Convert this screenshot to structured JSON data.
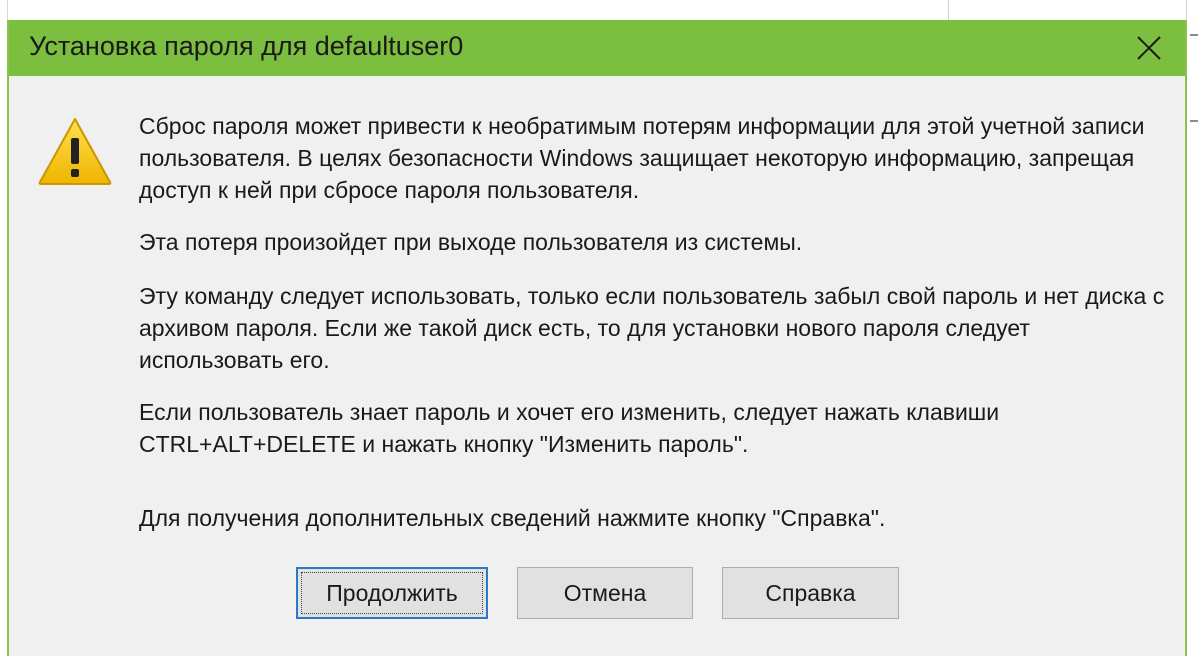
{
  "window": {
    "title": "Установка пароля для defaultuser0"
  },
  "message": {
    "paragraph_1": "Сброс пароля может привести к необратимым потерям информации для этой учетной записи пользователя. В целях безопасности Windows защищает некоторую информацию, запрещая доступ к ней при сбросе пароля пользователя.",
    "paragraph_2": "Эта потеря произойдет при выходе пользователя из системы.",
    "paragraph_3": "Эту команду следует использовать, только если пользователь забыл свой пароль и нет диска с архивом пароля. Если же такой диск есть, то для установки нового пароля следует использовать его.",
    "paragraph_4": "Если пользователь знает пароль и хочет его изменить, следует нажать клавиши CTRL+ALT+DELETE и нажать кнопку \"Изменить пароль\".",
    "paragraph_5": "Для получения дополнительных сведений нажмите кнопку \"Справка\"."
  },
  "buttons": {
    "continue_label": "Продолжить",
    "cancel_label": "Отмена",
    "help_label": "Справка"
  },
  "icons": {
    "warning": "warning-icon",
    "close": "close-icon"
  },
  "colors": {
    "titlebar": "#7cbe3f",
    "default_button_border": "#2d76c8",
    "warning_fill": "#f5c400"
  }
}
